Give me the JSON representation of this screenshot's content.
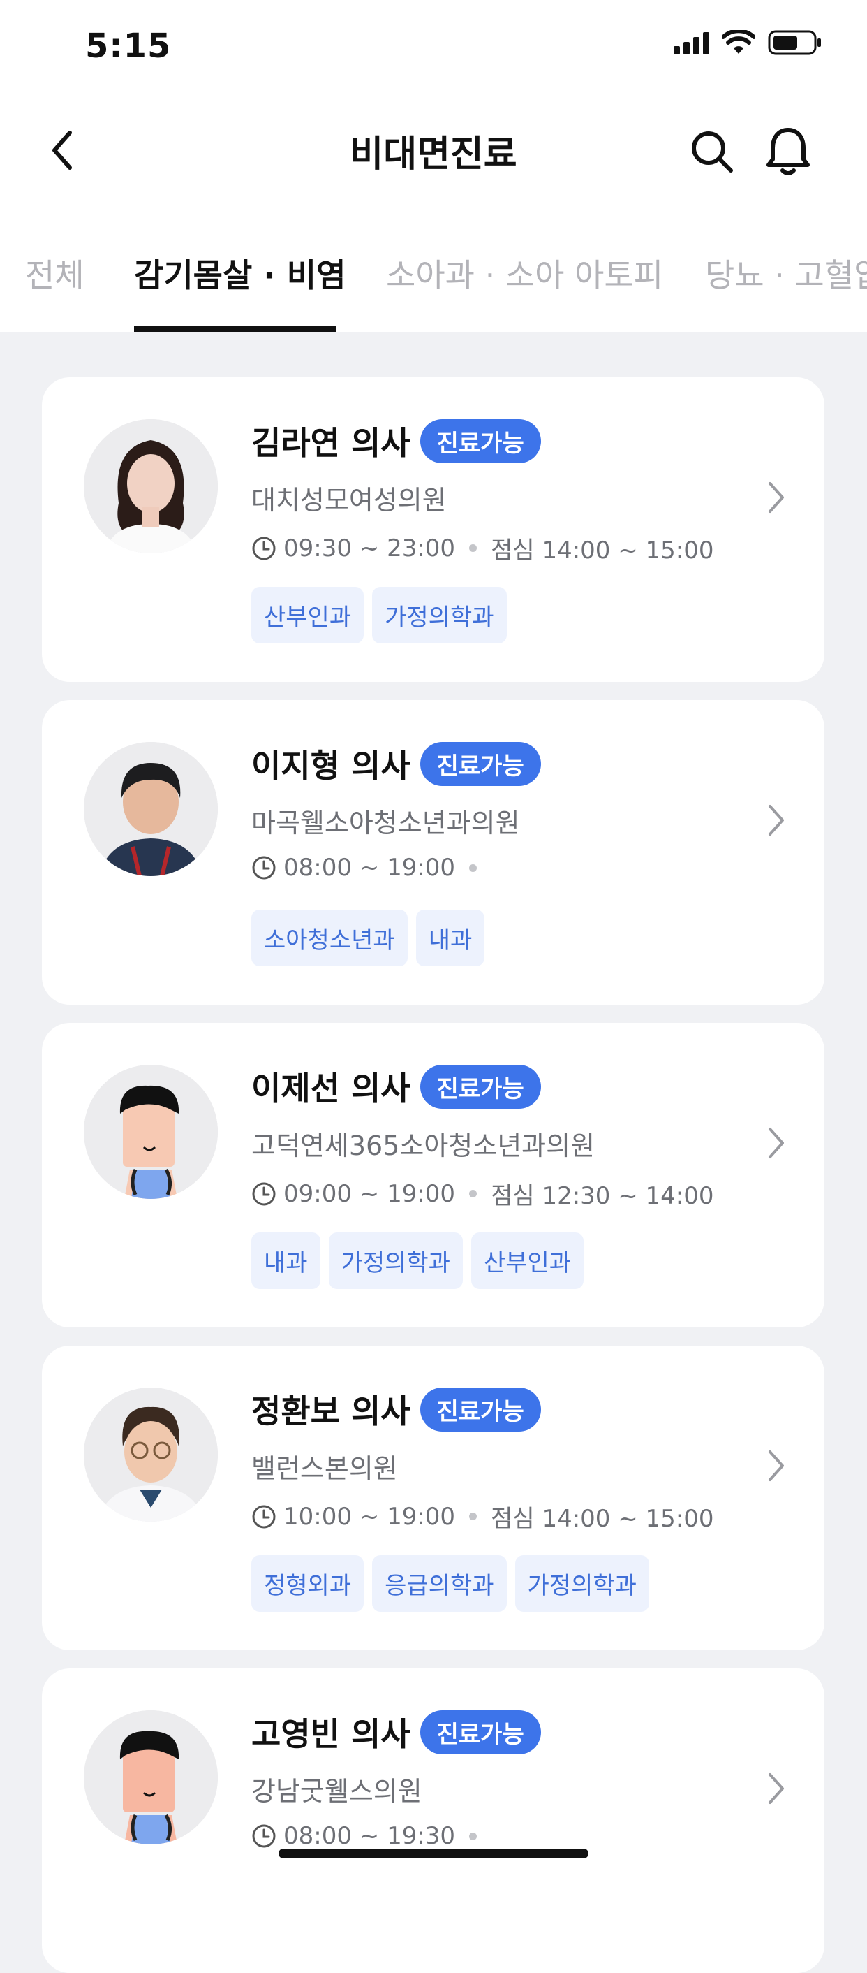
{
  "status": {
    "time": "5:15"
  },
  "header": {
    "title": "비대면진료"
  },
  "tabs": [
    "전체",
    "감기몸살 · 비염",
    "소아과 · 소아 아토피",
    "당뇨 · 고혈압"
  ],
  "active_tab": "감기몸살 · 비염",
  "doctors": [
    {
      "name": "김라연 의사",
      "badge": "진료가능",
      "clinic": "대치성모여성의원",
      "hours": "09:30 ~ 23:00",
      "lunch": "점심 14:00 ~ 15:00",
      "tags": [
        "산부인과",
        "가정의학과"
      ]
    },
    {
      "name": "이지형 의사",
      "badge": "진료가능",
      "clinic": "마곡웰소아청소년과의원",
      "hours": "08:00 ~ 19:00",
      "lunch": "",
      "tags": [
        "소아청소년과",
        "내과"
      ]
    },
    {
      "name": "이제선 의사",
      "badge": "진료가능",
      "clinic": "고덕연세365소아청소년과의원",
      "hours": "09:00 ~ 19:00",
      "lunch": "점심 12:30 ~ 14:00",
      "tags": [
        "내과",
        "가정의학과",
        "산부인과"
      ]
    },
    {
      "name": "정환보 의사",
      "badge": "진료가능",
      "clinic": "밸런스본의원",
      "hours": "10:00 ~ 19:00",
      "lunch": "점심 14:00 ~ 15:00",
      "tags": [
        "정형외과",
        "응급의학과",
        "가정의학과"
      ]
    },
    {
      "name": "고영빈 의사",
      "badge": "진료가능",
      "clinic": "강남굿웰스의원",
      "hours": "08:00 ~ 19:30",
      "lunch": "",
      "tags": []
    }
  ],
  "colors": {
    "accent": "#3d74ea",
    "tag_bg": "#edf2fd",
    "tag_text": "#3f6fd8",
    "page_bg": "#f0f1f4"
  }
}
